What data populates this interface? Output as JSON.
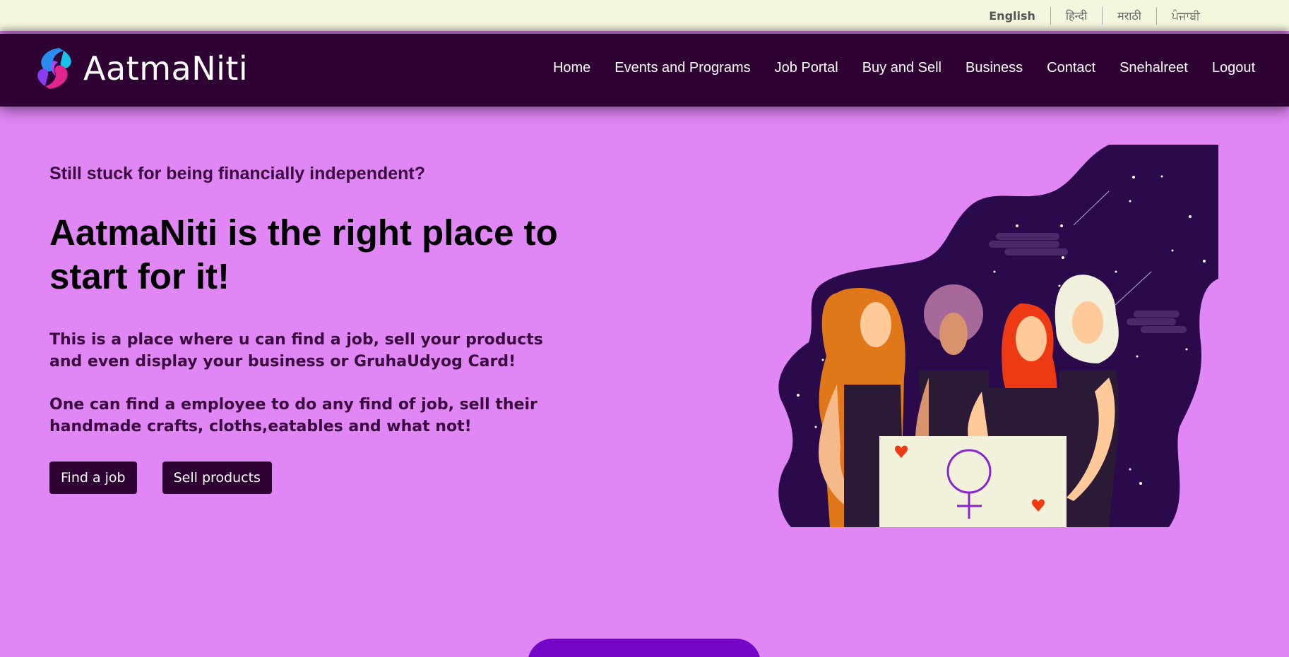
{
  "languages": [
    "English",
    "हिन्दी",
    "मराठी",
    "ਪੰਜਾਬੀ"
  ],
  "brand": {
    "name": "AatmaNiti"
  },
  "nav": [
    "Home",
    "Events and Programs",
    "Job Portal",
    "Buy and Sell",
    "Business",
    "Contact",
    "Snehalreet",
    "Logout"
  ],
  "hero": {
    "kicker": "Still stuck for being financially independent?",
    "title": "AatmaNiti is the right place to start for it!",
    "para1": "This is a place where u can find a job, sell your products and even display your business or GruhaUdyog Card!",
    "para2": "One can find a employee to do any find of job, sell their handmade crafts, cloths,eatables and what not!",
    "buttons": {
      "find_job": "Find a job",
      "sell_products": "Sell products"
    }
  },
  "colors": {
    "page_bg": "#e086f5",
    "nav_bg": "#2e0334",
    "lang_bar_bg": "#f4f6de",
    "accent": "#7505c7"
  }
}
